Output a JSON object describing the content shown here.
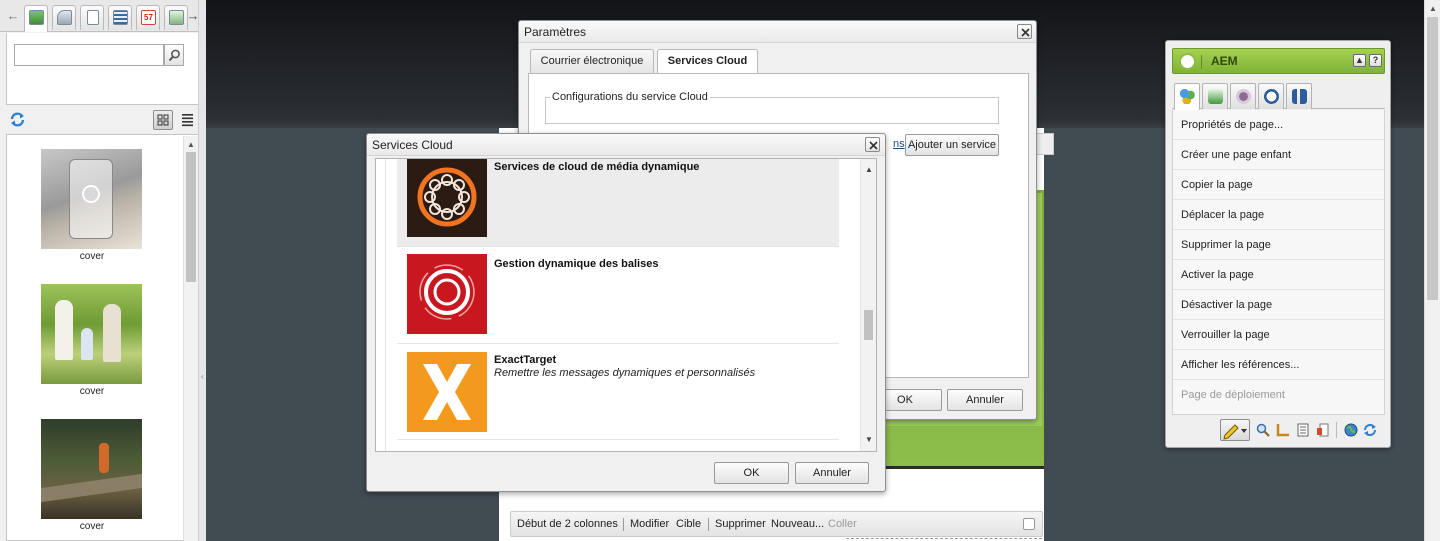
{
  "finder": {
    "search": {
      "value": "",
      "placeholder": ""
    },
    "tabs": [
      "images-icon",
      "products-icon",
      "documents-icon",
      "media-icon",
      "flash-icon",
      "paragraphs-icon"
    ],
    "thumbnails": [
      {
        "caption": "cover"
      },
      {
        "caption": "cover"
      },
      {
        "caption": "cover"
      }
    ]
  },
  "parametres_dialog": {
    "title": "Paramètres",
    "tabs": [
      {
        "label": "Courrier électronique"
      },
      {
        "label": "Services Cloud"
      }
    ],
    "fieldset_legend": "Configurations du service Cloud",
    "partial_link": "ns",
    "add_service_label": "Ajouter un service",
    "ok_label": "OK",
    "cancel_label": "Annuler"
  },
  "services_dialog": {
    "title": "Services Cloud",
    "services": [
      {
        "name": "Services de cloud de média dynamique",
        "description": "",
        "logo": "dynamic-media-logo-icon"
      },
      {
        "name": "Gestion dynamique des balises",
        "description": "",
        "logo": "dynamic-tag-management-logo-icon"
      },
      {
        "name": "ExactTarget",
        "description": "Remettre les messages dynamiques et personnalisés",
        "logo": "exacttarget-logo-icon"
      }
    ],
    "ok_label": "OK",
    "cancel_label": "Annuler"
  },
  "component_bar": {
    "title": "Début de 2 colonnes",
    "actions": [
      "Modifier",
      "Cible",
      "Supprimer",
      "Nouveau...",
      "Coller"
    ]
  },
  "sidekick": {
    "title": "AEM",
    "menu": [
      {
        "label": "Propriétés de page...",
        "enabled": true
      },
      {
        "label": "Créer une page enfant",
        "enabled": true
      },
      {
        "label": "Copier la page",
        "enabled": true
      },
      {
        "label": "Déplacer la page",
        "enabled": true
      },
      {
        "label": "Supprimer la page",
        "enabled": true
      },
      {
        "label": "Activer la page",
        "enabled": true
      },
      {
        "label": "Désactiver la page",
        "enabled": true
      },
      {
        "label": "Verrouiller la page",
        "enabled": true
      },
      {
        "label": "Afficher les références...",
        "enabled": true
      },
      {
        "label": "Page de déploiement",
        "enabled": false
      }
    ]
  },
  "colors": {
    "aem_green": "#8cbd3f",
    "page_green": "#86b846",
    "dtm_red": "#c8171e",
    "exacttarget_orange": "#f39a1e"
  }
}
